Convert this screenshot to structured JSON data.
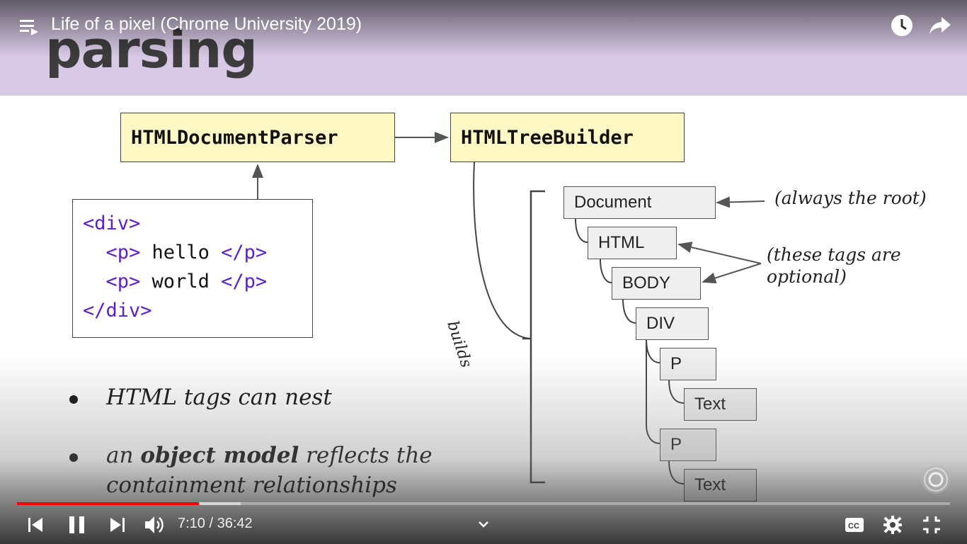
{
  "video": {
    "title": "Life of a pixel (Chrome University 2019)",
    "current_time": "7:10",
    "duration": "36:42",
    "time_display": "7:10 / 36:42",
    "progress_fraction": 0.195,
    "buffered_fraction": 0.24
  },
  "slide": {
    "title": "parsing",
    "parser_box": "HTMLDocumentParser",
    "builder_box": "HTMLTreeBuilder",
    "code": {
      "line1_tag": "<div>",
      "line2_open": "<p>",
      "line2_text": " hello ",
      "line2_close": "</p>",
      "line3_open": "<p>",
      "line3_text": " world ",
      "line3_close": "</p>",
      "line4_tag": "</div>"
    },
    "tree_nodes": [
      "Document",
      "HTML",
      "BODY",
      "DIV",
      "P",
      "Text",
      "P",
      "Text"
    ],
    "note_root": "(always the root)",
    "note_optional_1": "(these tags are",
    "note_optional_2": "optional)",
    "builds_label": "builds",
    "bullet1": "HTML tags can nest",
    "bullet2_pre": "an ",
    "bullet2_bold": "object model",
    "bullet2_post": " reflects the",
    "bullet2_line2": "containment relationships"
  },
  "colors": {
    "header_bg": "#d8c9e6",
    "box_yellow": "#fdf8c4",
    "tag_purple": "#5b1fd1",
    "progress_red": "#ff0000"
  },
  "icons": {
    "playlist": "playlist-icon",
    "watch_later": "clock-icon",
    "share": "share-icon",
    "previous": "skip-previous-icon",
    "pause": "pause-icon",
    "next": "skip-next-icon",
    "volume": "volume-icon",
    "chevron": "chevron-down-icon",
    "captions": "captions-icon",
    "settings": "gear-icon",
    "exit_fullscreen": "exit-fullscreen-icon",
    "watermark": "chrome-logo-icon"
  }
}
